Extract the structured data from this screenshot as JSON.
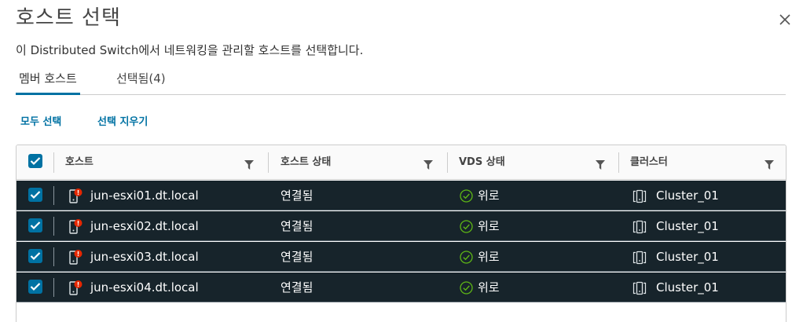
{
  "dialog": {
    "title": "호스트 선택",
    "description": "이 Distributed Switch에서 네트워킹을 관리할 호스트를 선택합니다."
  },
  "tabs": [
    {
      "label": "멤버 호스트",
      "active": true
    },
    {
      "label": "선택됨(4)",
      "active": false
    }
  ],
  "actions": {
    "select_all": "모두 선택",
    "clear_selection": "선택 지우기"
  },
  "grid": {
    "header_all_checked": true,
    "columns": [
      "호스트",
      "호스트 상태",
      "VDS 상태",
      "클러스터"
    ],
    "rows": [
      {
        "checked": true,
        "host": "jun-esxi01.dt.local",
        "host_state": "연결됨",
        "vds_state": "위로",
        "cluster": "Cluster_01"
      },
      {
        "checked": true,
        "host": "jun-esxi02.dt.local",
        "host_state": "연결됨",
        "vds_state": "위로",
        "cluster": "Cluster_01"
      },
      {
        "checked": true,
        "host": "jun-esxi03.dt.local",
        "host_state": "연결됨",
        "vds_state": "위로",
        "cluster": "Cluster_01"
      },
      {
        "checked": true,
        "host": "jun-esxi04.dt.local",
        "host_state": "연결됨",
        "vds_state": "위로",
        "cluster": "Cluster_01"
      }
    ]
  },
  "colors": {
    "accent": "#0072a3",
    "selected_row": "#17242b",
    "status_ok": "#5eb715",
    "warning_badge": "#e62700"
  }
}
